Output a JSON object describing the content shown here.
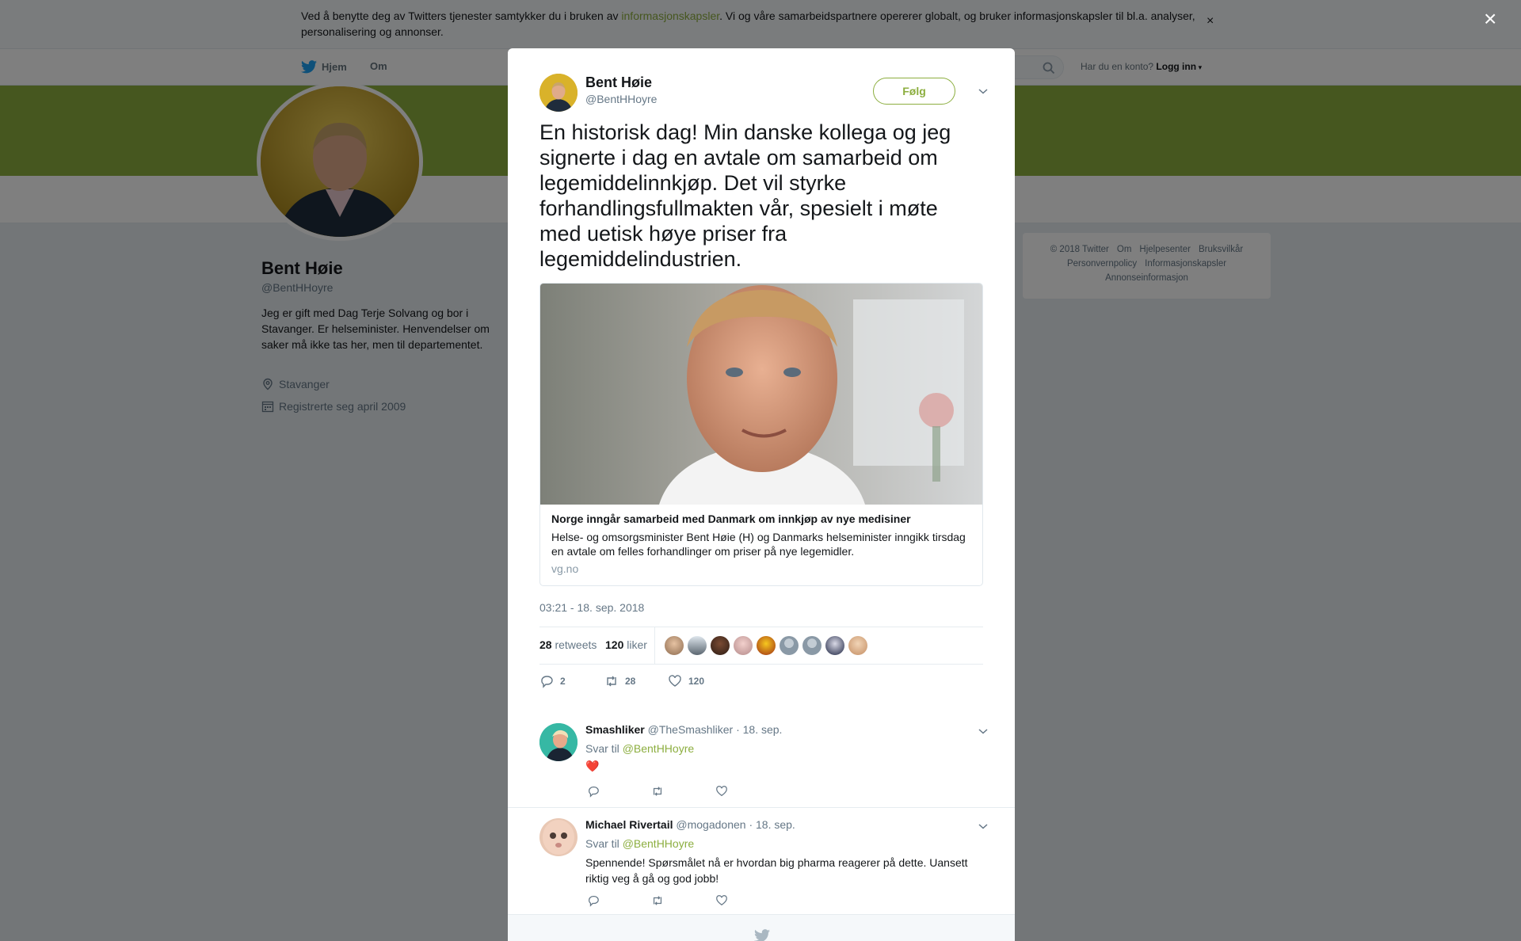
{
  "cookie": {
    "text_before": "Ved å benytte deg av Twitters tjenester samtykker du i bruken av ",
    "link": "informasjonskapsler",
    "text_after": ". Vi og våre samarbeidspartnere opererer globalt, og bruker informasjonskapsler til bl.a. analyser, personalisering og annonser.",
    "close": "×"
  },
  "nav": {
    "home": "Hjem",
    "about": "Om",
    "login_question": "Har du en konto?",
    "login": "Logg inn"
  },
  "profile": {
    "name": "Bent Høie",
    "handle": "@BentHHoyre",
    "bio": "Jeg er gift med Dag Terje Solvang og bor i Stavanger. Er helseminister. Henvendelser om saker må ikke tas her, men til departementet.",
    "location": "Stavanger",
    "joined": "Registrerte seg april 2009"
  },
  "footer": {
    "copyright": "© 2018 Twitter",
    "links": [
      "Om",
      "Hjelpesenter",
      "Bruksvilkår",
      "Personvernpolicy",
      "Informasjonskapsler",
      "Annonseinformasjon"
    ]
  },
  "overlay_close": "×",
  "tweet": {
    "author_name": "Bent Høie",
    "author_handle": "@BentHHoyre",
    "follow": "Følg",
    "text": "En historisk dag! Min danske kollega og jeg signerte i dag en avtale om samarbeid om legemiddelinnkjøp. Det vil styrke forhandlingsfullmakten vår, spesielt i møte med uetisk høye priser fra legemiddelindustrien.",
    "card": {
      "title": "Norge inngår samarbeid med Danmark om innkjøp av nye medisiner",
      "description": "Helse- og omsorgsminister Bent Høie (H) og Danmarks helseminister inngikk tirsdag en avtale om felles forhandlinger om priser på nye legemidler.",
      "domain": "vg.no"
    },
    "timestamp": "03:21 - 18. sep. 2018",
    "retweets_count": "28",
    "retweets_label": "retweets",
    "likes_count": "120",
    "likes_label": "liker",
    "reply_count": "2",
    "retweet_count": "28",
    "like_count": "120"
  },
  "replies": [
    {
      "name": "Smashliker",
      "handle": "@TheSmashliker",
      "date": "· 18. sep.",
      "reply_to_label": "Svar til",
      "reply_to": "@BentHHoyre",
      "text": "❤️"
    },
    {
      "name": "Michael Rivertail",
      "handle": "@mogadonen",
      "date": "· 18. sep.",
      "reply_to_label": "Svar til",
      "reply_to": "@BentHHoyre",
      "text": "Spennende! Spørsmålet nå er hvordan big pharma reagerer på dette. Uansett riktig veg å gå og god jobb!"
    }
  ],
  "colors": {
    "accent": "#8cae3f",
    "banner": "#8cae3f",
    "muted": "#657786"
  }
}
